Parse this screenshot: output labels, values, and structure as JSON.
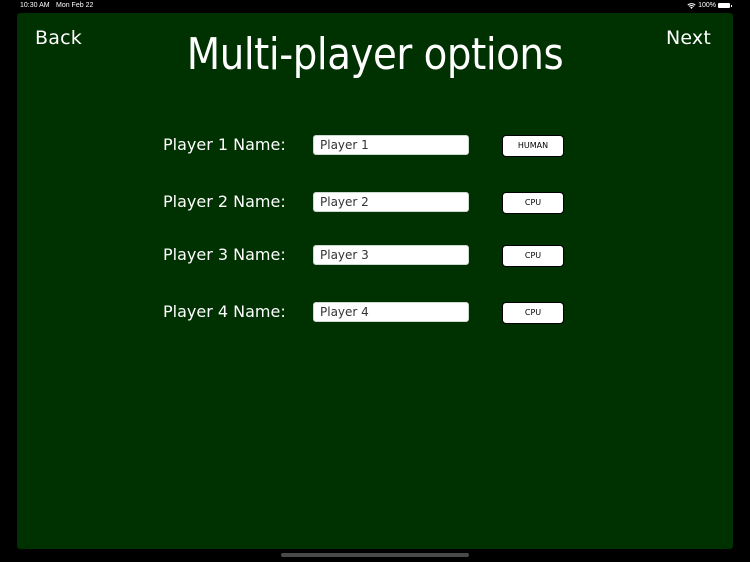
{
  "status_bar": {
    "time": "10:30 AM",
    "date": "Mon Feb 22",
    "battery": "100%",
    "icons": [
      "wifi-icon",
      "battery-icon"
    ]
  },
  "header": {
    "back_label": "Back",
    "title": "Multi-player options",
    "next_label": "Next"
  },
  "players": [
    {
      "label": "Player 1 Name:",
      "value": "Player 1",
      "type": "HUMAN"
    },
    {
      "label": "Player 2 Name:",
      "value": "Player 2",
      "type": "CPU"
    },
    {
      "label": "Player 3 Name:",
      "value": "Player 3",
      "type": "CPU"
    },
    {
      "label": "Player 4 Name:",
      "value": "Player 4",
      "type": "CPU"
    }
  ],
  "colors": {
    "background": "#003100",
    "text": "#ffffff",
    "button_bg": "#ffffff"
  }
}
